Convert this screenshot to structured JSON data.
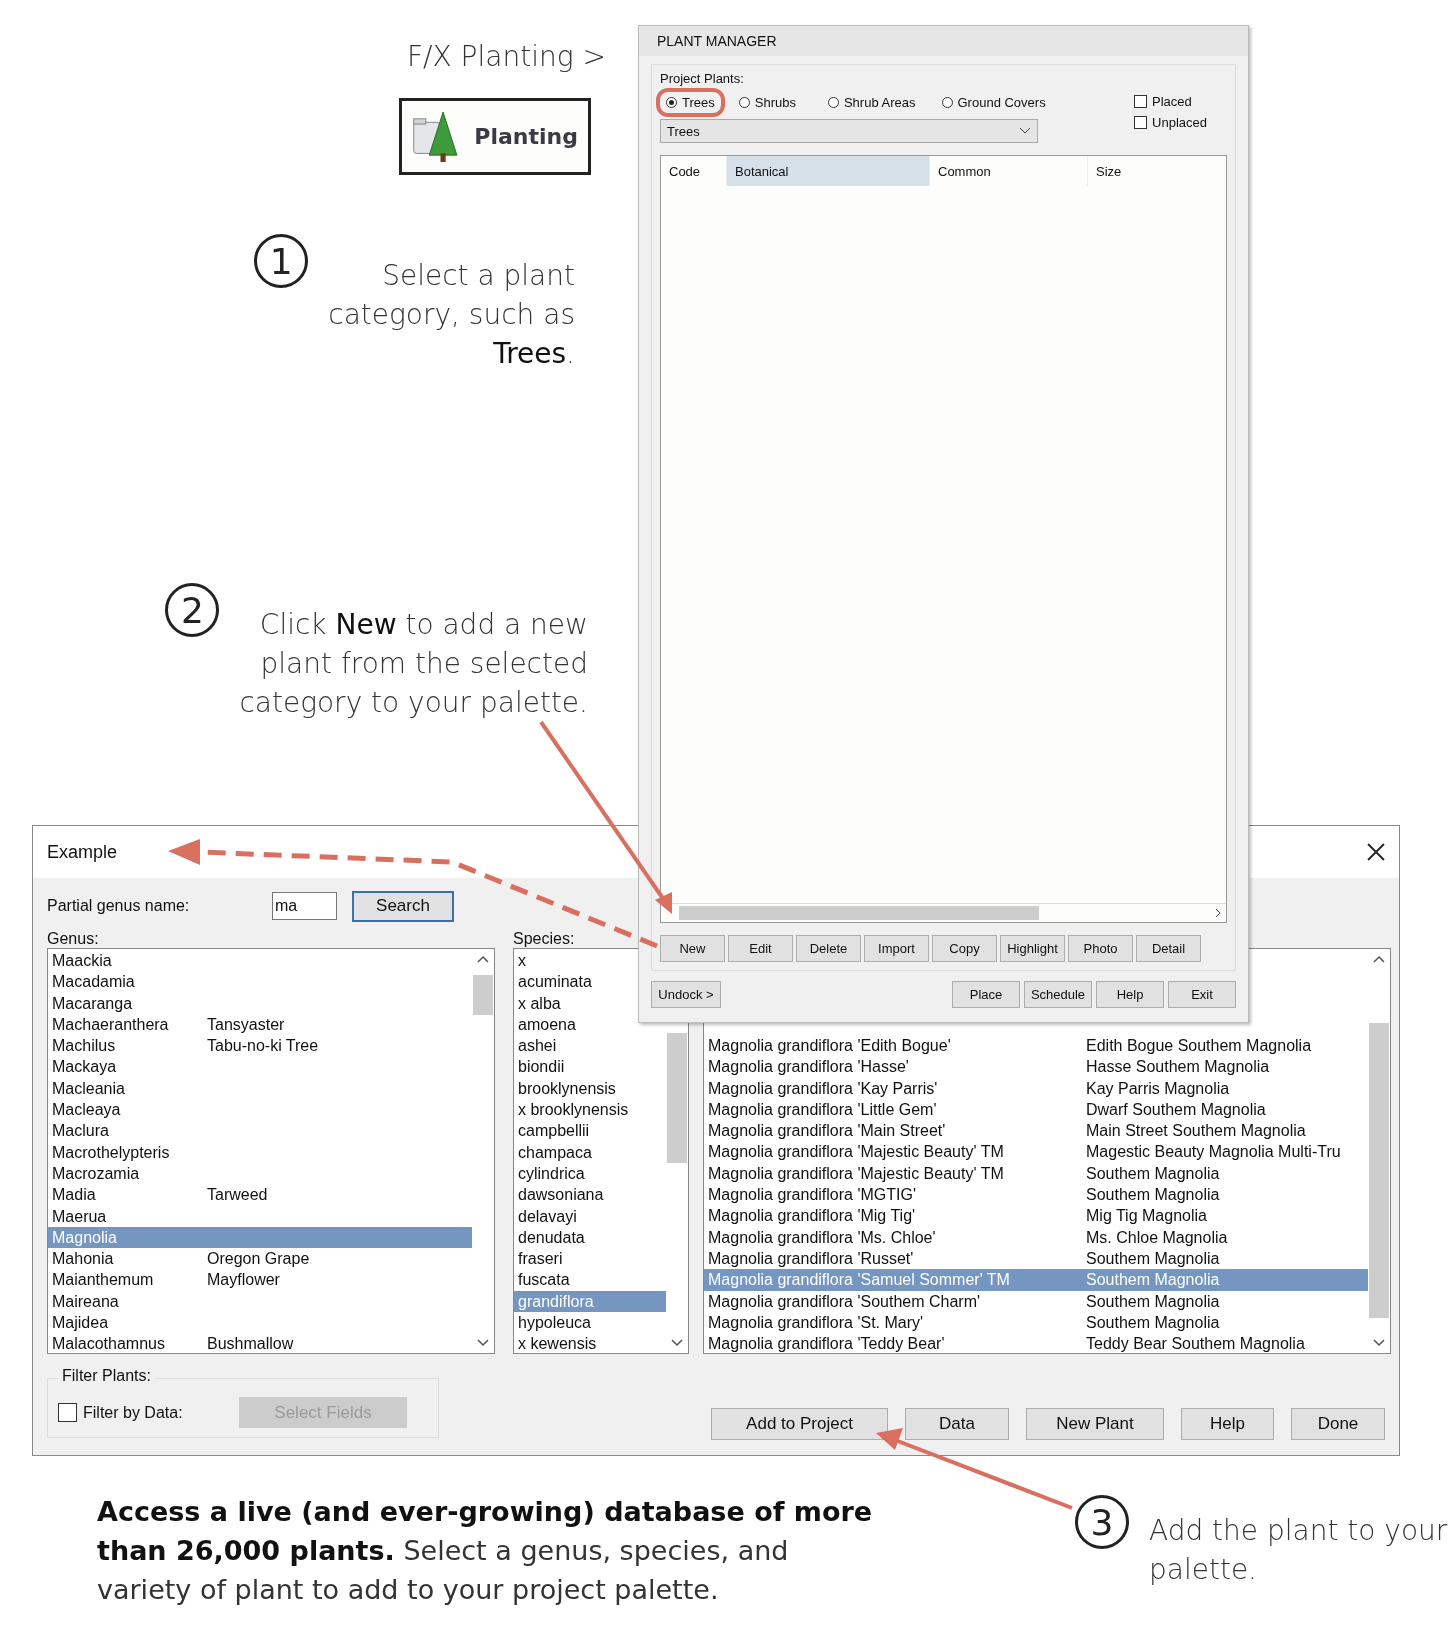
{
  "header": {
    "breadcrumb": "F/X Planting >",
    "ribbon_button": "Planting"
  },
  "steps": [
    {
      "number": "1",
      "lines": [
        "Select a plant",
        "category, such as",
        "**Trees**."
      ]
    },
    {
      "number": "2",
      "lines": [
        "Click **New** to add a new",
        "plant from the selected",
        "category to your palette."
      ]
    },
    {
      "number": "3",
      "lines": [
        "Add the plant to your",
        "palette."
      ]
    }
  ],
  "caption": [
    "**Access a live (and ever-growing) database of more**",
    "**than 26,000 plants.** Select a genus, species, and",
    "variety of plant to add to your project palette."
  ],
  "plant_manager": {
    "title": "PLANT MANAGER",
    "group_label": "Project Plants:",
    "radios": [
      {
        "label": "Trees",
        "selected": true,
        "highlighted": true
      },
      {
        "label": "Shrubs",
        "selected": false,
        "highlighted": false
      },
      {
        "label": "Shrub Areas",
        "selected": false,
        "highlighted": false
      },
      {
        "label": "Ground Covers",
        "selected": false,
        "highlighted": false
      }
    ],
    "checkboxes": [
      {
        "label": "Placed",
        "checked": false
      },
      {
        "label": "Unplaced",
        "checked": false
      }
    ],
    "dropdown": "Trees",
    "columns": [
      {
        "label": "Code",
        "selected": false
      },
      {
        "label": "Botanical",
        "selected": true
      },
      {
        "label": "Common",
        "selected": false
      },
      {
        "label": "Size",
        "selected": false
      }
    ],
    "buttons": [
      "New",
      "Edit",
      "Delete",
      "Import",
      "Copy",
      "Highlight",
      "Photo",
      "Detail"
    ],
    "footer_left": "Undock >",
    "footer_buttons": [
      "Place",
      "Schedule",
      "Help",
      "Exit"
    ]
  },
  "example_dialog": {
    "title": "Example",
    "search_label": "Partial genus name:",
    "search_value": "ma",
    "search_button": "Search",
    "genus_label": "Genus:",
    "species_label": "Species:",
    "genus": [
      {
        "name": "Maackia",
        "selected": false
      },
      {
        "name": "Macadamia",
        "selected": false
      },
      {
        "name": "Macaranga",
        "selected": false
      },
      {
        "name": "Machaeranthera",
        "common": "Tansyaster",
        "selected": false
      },
      {
        "name": "Machilus",
        "common": "Tabu-no-ki Tree",
        "selected": false
      },
      {
        "name": "Mackaya",
        "selected": false
      },
      {
        "name": "Macleania",
        "selected": false
      },
      {
        "name": "Macleaya",
        "selected": false
      },
      {
        "name": "Maclura",
        "selected": false
      },
      {
        "name": "Macrothelypteris",
        "selected": false
      },
      {
        "name": "Macrozamia",
        "selected": false
      },
      {
        "name": "Madia",
        "common": "Tarweed",
        "selected": false
      },
      {
        "name": "Maerua",
        "selected": false
      },
      {
        "name": "Magnolia",
        "selected": true
      },
      {
        "name": "Mahonia",
        "common": "Oregon Grape",
        "selected": false
      },
      {
        "name": "Maianthemum",
        "common": "Mayflower",
        "selected": false
      },
      {
        "name": "Maireana",
        "selected": false
      },
      {
        "name": "Majidea",
        "selected": false
      },
      {
        "name": "Malacothamnus",
        "common": "Bushmallow",
        "selected": false
      }
    ],
    "species": [
      {
        "name": "x",
        "selected": false
      },
      {
        "name": "acuminata",
        "selected": false
      },
      {
        "name": "x alba",
        "selected": false
      },
      {
        "name": "amoena",
        "selected": false
      },
      {
        "name": "ashei",
        "selected": false
      },
      {
        "name": "biondii",
        "selected": false
      },
      {
        "name": "brooklynensis",
        "selected": false
      },
      {
        "name": "x brooklynensis",
        "selected": false
      },
      {
        "name": "campbellii",
        "selected": false
      },
      {
        "name": "champaca",
        "selected": false
      },
      {
        "name": "cylindrica",
        "selected": false
      },
      {
        "name": "dawsoniana",
        "selected": false
      },
      {
        "name": "delavayi",
        "selected": false
      },
      {
        "name": "denudata",
        "selected": false
      },
      {
        "name": "fraseri",
        "selected": false
      },
      {
        "name": "fuscata",
        "selected": false
      },
      {
        "name": "grandiflora",
        "selected": true
      },
      {
        "name": "hypoleuca",
        "selected": false
      },
      {
        "name": "x kewensis",
        "selected": false
      }
    ],
    "varieties": [
      {
        "botanical": "Magnolia grandiflora 'Edith Bogue'",
        "common": "Edith Bogue Southem Magnolia",
        "selected": false
      },
      {
        "botanical": "Magnolia grandiflora 'Hasse'",
        "common": "Hasse Southem Magnolia",
        "selected": false
      },
      {
        "botanical": "Magnolia grandiflora 'Kay Parris'",
        "common": "Kay Parris Magnolia",
        "selected": false
      },
      {
        "botanical": "Magnolia grandiflora 'Little Gem'",
        "common": "Dwarf Southem Magnolia",
        "selected": false
      },
      {
        "botanical": "Magnolia grandiflora 'Main Street'",
        "common": "Main Street Southem Magnolia",
        "selected": false
      },
      {
        "botanical": "Magnolia grandiflora 'Majestic Beauty' TM",
        "common": "Magestic Beauty Magnolia Multi-Tru",
        "selected": false
      },
      {
        "botanical": "Magnolia grandiflora 'Majestic Beauty' TM",
        "common": "Southem Magnolia",
        "selected": false
      },
      {
        "botanical": "Magnolia grandiflora 'MGTIG'",
        "common": "Southem Magnolia",
        "selected": false
      },
      {
        "botanical": "Magnolia grandiflora 'Mig Tig'",
        "common": "Mig Tig Magnolia",
        "selected": false
      },
      {
        "botanical": "Magnolia grandiflora 'Ms. Chloe'",
        "common": "Ms. Chloe Magnolia",
        "selected": false
      },
      {
        "botanical": "Magnolia grandiflora 'Russet'",
        "common": "Southem Magnolia",
        "selected": false
      },
      {
        "botanical": "Magnolia grandiflora 'Samuel Sommer' TM",
        "common": "Southem Magnolia",
        "selected": true
      },
      {
        "botanical": "Magnolia grandiflora 'Southem Charm'",
        "common": "Southem Magnolia",
        "selected": false
      },
      {
        "botanical": "Magnolia grandiflora 'St. Mary'",
        "common": "Southem Magnolia",
        "selected": false
      },
      {
        "botanical": "Magnolia grandiflora 'Teddy Bear'",
        "common": "Teddy Bear Southem Magnolia",
        "selected": false
      }
    ],
    "filter_label": "Filter Plants:",
    "filter_checkbox": {
      "label": "Filter by Data:",
      "checked": false
    },
    "filter_button": {
      "label": "Select Fields",
      "disabled": true
    },
    "buttons": [
      "Add to Project",
      "Data",
      "New Plant",
      "Help",
      "Done"
    ]
  }
}
